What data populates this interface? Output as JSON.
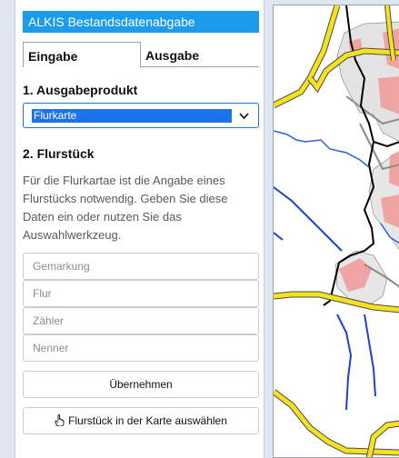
{
  "app": {
    "title": "ALKIS Bestandsdatenabgabe"
  },
  "tabs": [
    {
      "label": "Eingabe",
      "active": true
    },
    {
      "label": "Ausgabe",
      "active": false
    }
  ],
  "section1": {
    "title": "1. Ausgabeprodukt",
    "select_value": "Flurkarte"
  },
  "section2": {
    "title": "2. Flurstück",
    "description": "Für die Flurkartae ist die Angabe eines Flurstücks notwendig. Geben Sie diese Daten ein oder nutzen Sie das Auswahlwerkzeug."
  },
  "fields": {
    "gemarkung_placeholder": "Gemarkung",
    "flur_placeholder": "Flur",
    "zaehler_placeholder": "Zähler",
    "nenner_placeholder": "Nenner"
  },
  "buttons": {
    "apply_label": "Übernehmen",
    "select_on_map_label": "Flurstück in der Karte auswählen"
  },
  "colors": {
    "title_bar": "#1c9bea",
    "selection": "#1a73e8",
    "road_yellow": "#f5e11f",
    "settlement_pink": "#f0a3a3",
    "water_blue": "#1f3fd1",
    "boundary": "#000000"
  },
  "icons": [
    "chevron-down-icon",
    "pointing-hand-icon"
  ]
}
